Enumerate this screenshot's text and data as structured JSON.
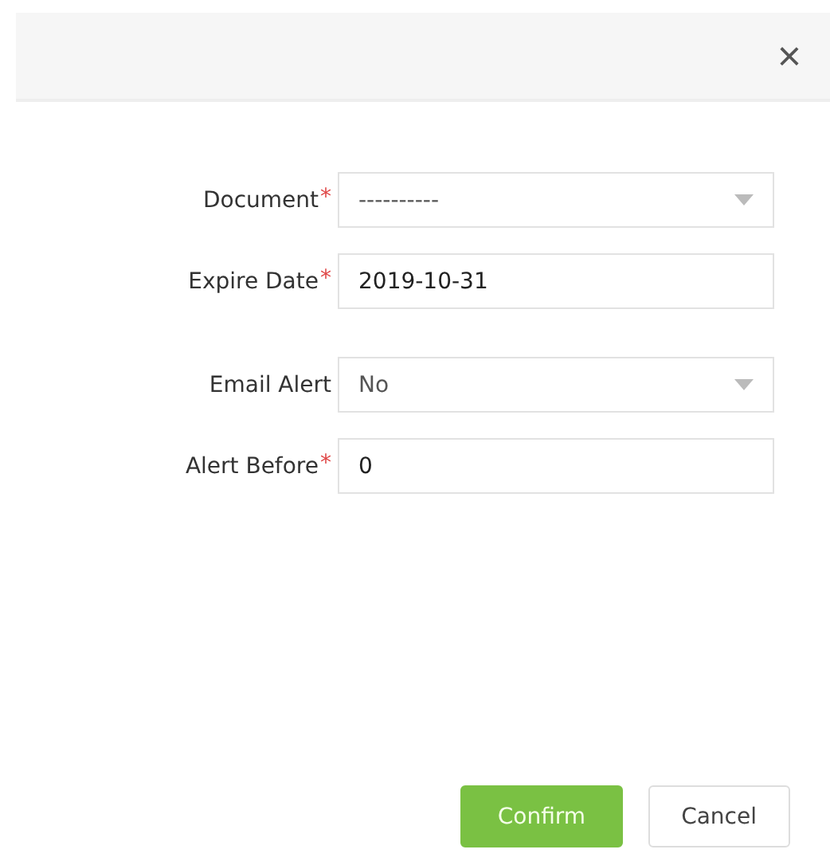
{
  "dialog": {
    "close": "×"
  },
  "groups": [
    [
      {
        "label": "Document",
        "required_mark": "*",
        "kind": "select",
        "value": "----------"
      },
      {
        "label": "Expire Date",
        "required_mark": "*",
        "kind": "text",
        "value": "2019-10-31"
      }
    ],
    [
      {
        "label": "Email Alert",
        "kind": "select",
        "value": "No"
      },
      {
        "label": "Alert Before",
        "required_mark": "*",
        "kind": "text",
        "value": "0"
      }
    ]
  ],
  "buttons": [
    {
      "label": "Confirm",
      "kind": "primary"
    },
    {
      "label": "Cancel",
      "kind": "secondary"
    }
  ]
}
